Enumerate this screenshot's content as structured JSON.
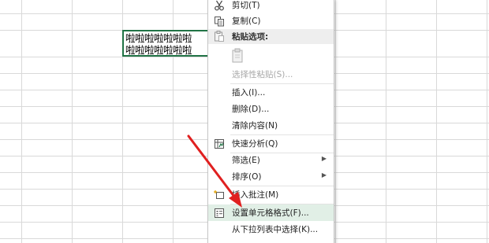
{
  "sheet": {
    "cell_text_line1": "啦啦啦啦啦啦啦",
    "cell_text_line2": "啦啦啦啦啦啦啦"
  },
  "context_menu": {
    "cut": "剪切(T)",
    "copy": "复制(C)",
    "paste_options": "粘贴选项:",
    "paste_special": "选择性粘贴(S)...",
    "insert": "插入(I)...",
    "delete": "删除(D)...",
    "clear_contents": "清除内容(N)",
    "quick_analysis": "快速分析(Q)",
    "filter": "筛选(E)",
    "sort": "排序(O)",
    "insert_comment": "插入批注(M)",
    "format_cells": "设置单元格格式(F)...",
    "pick_from_list": "从下拉列表中选择(K)..."
  },
  "colors": {
    "selection_border": "#217346",
    "highlight": "#e1efe6",
    "arrow": "#e02020"
  }
}
